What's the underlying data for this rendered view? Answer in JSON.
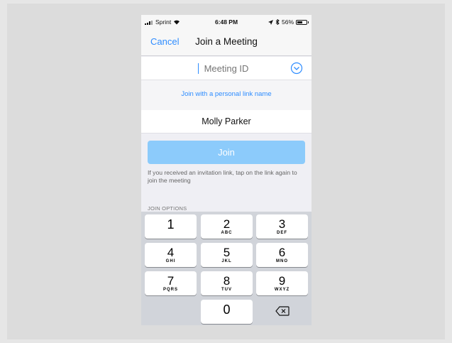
{
  "status_bar": {
    "carrier": "Sprint",
    "time": "6:48 PM",
    "battery": "56%",
    "battery_level": 0.56
  },
  "nav": {
    "cancel_label": "Cancel",
    "title": "Join a Meeting"
  },
  "meeting_id": {
    "placeholder": "Meeting ID",
    "value": ""
  },
  "personal_link_label": "Join with a personal link name",
  "name_field": {
    "value": "Molly Parker"
  },
  "join_label": "Join",
  "hint_text": "If you received an invitation link, tap on the link again to join the meeting",
  "join_options_label": "JOIN OPTIONS",
  "keypad": [
    {
      "num": "1",
      "letters": ""
    },
    {
      "num": "2",
      "letters": "ABC"
    },
    {
      "num": "3",
      "letters": "DEF"
    },
    {
      "num": "4",
      "letters": "GHI"
    },
    {
      "num": "5",
      "letters": "JKL"
    },
    {
      "num": "6",
      "letters": "MNO"
    },
    {
      "num": "7",
      "letters": "PQRS"
    },
    {
      "num": "8",
      "letters": "TUV"
    },
    {
      "num": "9",
      "letters": "WXYZ"
    },
    {
      "num": "0",
      "letters": ""
    }
  ],
  "icons": {
    "expand": "chevron-circle-down-icon",
    "delete": "backspace-icon"
  },
  "colors": {
    "accent": "#2d8cff",
    "join_button": "#8ccbfb"
  }
}
